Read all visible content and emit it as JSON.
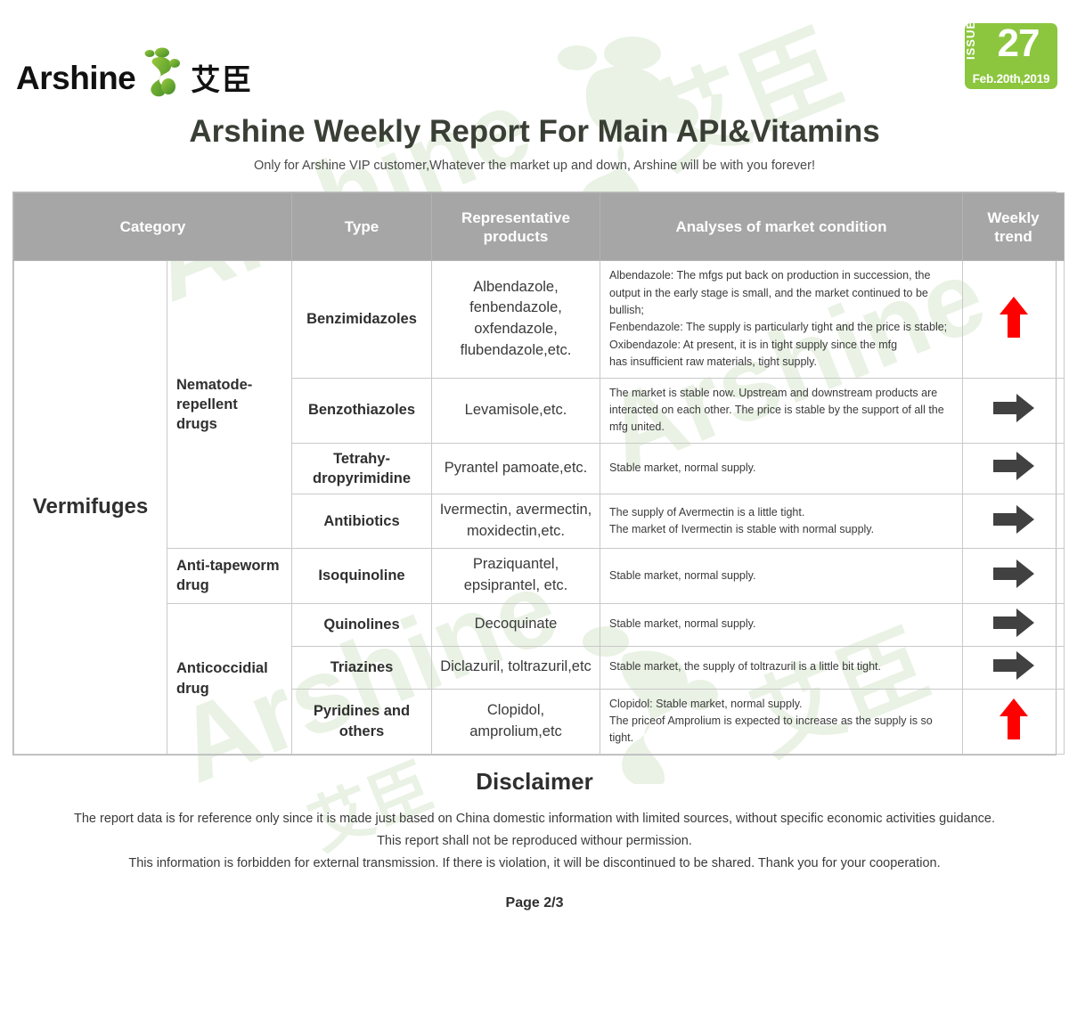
{
  "brand": {
    "logo_word": "Arshine",
    "logo_cn": "艾臣",
    "logo_mark_icon": "arshine-molecule-logo-icon",
    "green": "#8CC63E",
    "logo_green_dark": "#4e9b2f",
    "logo_green_light": "#9ccb3b"
  },
  "issue_badge": {
    "label": "ISSUE",
    "number": "27",
    "date": "Feb.20th,2019"
  },
  "title": {
    "main": "Arshine Weekly Report For Main API&Vitamins",
    "sub": "Only for Arshine VIP customer,Whatever the market up and down, Arshine will be with you forever!"
  },
  "watermark": {
    "text": "Arshine 艾臣",
    "color": "#e9f2e4"
  },
  "table": {
    "headers": {
      "category": "Category",
      "type": "Type",
      "representative_products": "Representative products",
      "analyses": "Analyses of market condition",
      "weekly_trend": "Weekly trend"
    },
    "category": "Vermifuges",
    "subcategories": [
      {
        "label": "Nematode-repellent drugs",
        "rowspan": 4
      },
      {
        "label": "Anti-tapeworm drug",
        "rowspan": 1
      },
      {
        "label": "Anticoccidial drug",
        "rowspan": 3
      }
    ],
    "rows": [
      {
        "type": "Benzimidazoles",
        "products": "Albendazole, fenbendazole, oxfendazole, flubendazole,etc.",
        "analyses": "Albendazole: The mfgs put back on production in succession, the output in the early stage is small, and the market continued to be bullish;\nFenbendazole: The supply is particularly tight and the price is stable;\nOxibendazole: At present, it is in tight supply since the mfg\nhas insufficient raw materials, tight supply.",
        "trend": "up",
        "trend_color": "#FF0000"
      },
      {
        "type": "Benzothiazoles",
        "products": "Levamisole,etc.",
        "analyses": "The market is stable now. Upstream and downstream products are interacted on each other. The price is stable by the support of all the mfg united.",
        "trend": "flat",
        "trend_color": "#414141"
      },
      {
        "type": "Tetrahy-dropyrimidine",
        "products": "Pyrantel pamoate,etc.",
        "analyses": "Stable market, normal supply.",
        "trend": "flat",
        "trend_color": "#414141"
      },
      {
        "type": "Antibiotics",
        "products": "Ivermectin, avermectin, moxidectin,etc.",
        "analyses": "The supply of Avermectin is a little tight.\nThe market of Ivermectin is stable with normal supply.",
        "trend": "flat",
        "trend_color": "#414141"
      },
      {
        "type": "Isoquinoline",
        "products": "Praziquantel, epsiprantel, etc.",
        "analyses": "Stable market, normal supply.",
        "trend": "flat",
        "trend_color": "#414141"
      },
      {
        "type": "Quinolines",
        "products": "Decoquinate",
        "analyses": "Stable market, normal supply.",
        "trend": "flat",
        "trend_color": "#414141"
      },
      {
        "type": "Triazines",
        "products": "Diclazuril, toltrazuril,etc",
        "analyses": "Stable market, the supply of toltrazuril is a little bit tight.",
        "trend": "flat",
        "trend_color": "#414141"
      },
      {
        "type": "Pyridines and others",
        "products": "Clopidol, amprolium,etc",
        "analyses": "Clopidol: Stable market, normal supply.\nThe priceof Amprolium is expected to increase as the supply is so tight.",
        "trend": "up",
        "trend_color": "#FF0000"
      }
    ]
  },
  "disclaimer": {
    "title": "Disclaimer",
    "lines": [
      "The report data is for reference only since it is made just based on China domestic information with limited sources, without specific economic activities guidance.",
      "This report shall not be reproduced withour permission.",
      "This information is forbidden for external transmission. If there is violation, it will be discontinued to be shared. Thank you for your cooperation."
    ]
  },
  "footer": {
    "page": "Page 2/3"
  }
}
